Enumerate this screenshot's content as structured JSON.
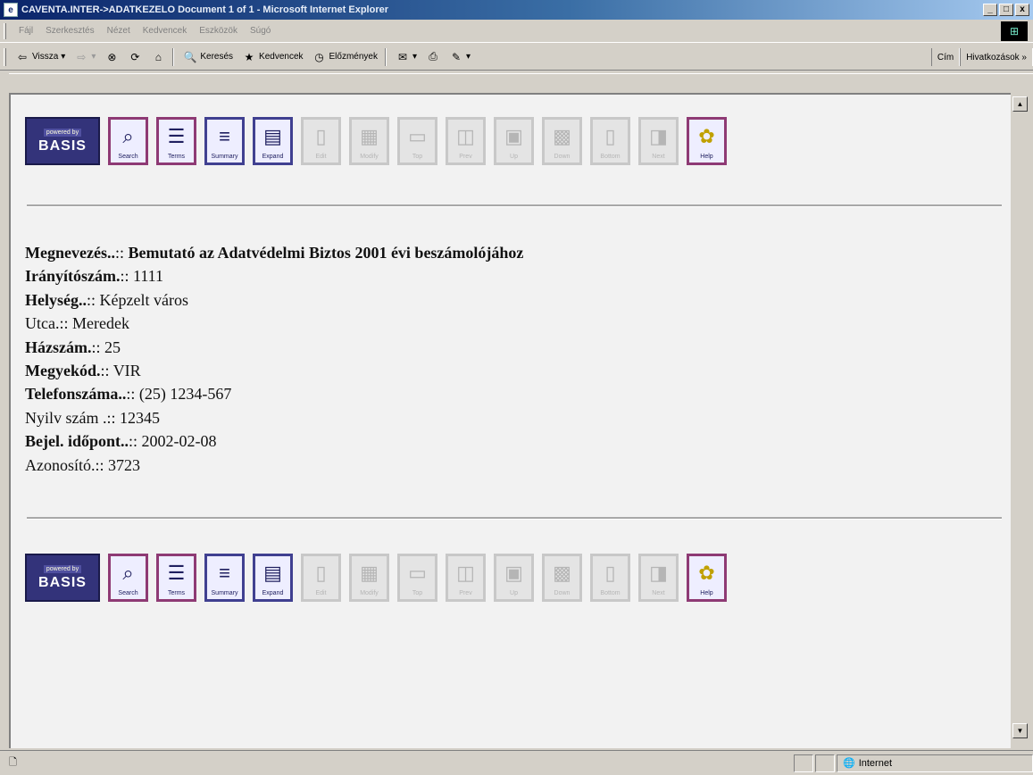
{
  "window": {
    "title": "CAVENTA.INTER->ADATKEZELO Document 1 of 1 - Microsoft Internet Explorer",
    "minimize": "_",
    "maximize": "□",
    "close": "x"
  },
  "menu": [
    "Fájl",
    "Szerkesztés",
    "Nézet",
    "Kedvencek",
    "Eszközök",
    "Súgó"
  ],
  "toolbar": {
    "back": "Vissza",
    "search": "Keresés",
    "favorites": "Kedvencek",
    "history": "Előzmények",
    "address_label": "Cím",
    "links_label": "Hivatkozások »"
  },
  "basis_logo": {
    "powered": "powered by",
    "name": "BASIS"
  },
  "tools": [
    {
      "label": "Search",
      "state": "on-pink",
      "icon": "magnifier-icon"
    },
    {
      "label": "Terms",
      "state": "on-pink",
      "icon": "terms-icon"
    },
    {
      "label": "Summary",
      "state": "on-blue",
      "icon": "summary-icon"
    },
    {
      "label": "Expand",
      "state": "on-blue",
      "icon": "expand-icon"
    },
    {
      "label": "Edit",
      "state": "off",
      "icon": "edit-icon"
    },
    {
      "label": "Modify",
      "state": "off",
      "icon": "modify-icon"
    },
    {
      "label": "Top",
      "state": "off",
      "icon": "top-icon"
    },
    {
      "label": "Prev",
      "state": "off",
      "icon": "prev-icon"
    },
    {
      "label": "Up",
      "state": "off",
      "icon": "up-icon"
    },
    {
      "label": "Down",
      "state": "off",
      "icon": "down-icon"
    },
    {
      "label": "Bottom",
      "state": "off",
      "icon": "bottom-icon"
    },
    {
      "label": "Next",
      "state": "off",
      "icon": "next-icon"
    },
    {
      "label": "Help",
      "state": "help",
      "icon": "help-icon"
    }
  ],
  "record": [
    {
      "label": "Megnevezés..",
      "value": "Bemutató az Adatvédelmi Biztos 2001 évi beszámolójához",
      "bold_value": true
    },
    {
      "label": "Irányítószám.",
      "value": "1111"
    },
    {
      "label": "Helység..",
      "value": "Képzelt város"
    },
    {
      "label": "Utca.",
      "value": "Meredek",
      "plain_label": true
    },
    {
      "label": "Házszám.",
      "value": "25"
    },
    {
      "label": "Megyekód.",
      "value": "VIR"
    },
    {
      "label": "Telefonszáma..",
      "value": "(25) 1234-567"
    },
    {
      "label": "Nyilv szám .",
      "value": "12345",
      "plain_label": true
    },
    {
      "label": "Bejel. időpont..",
      "value": "2002-02-08"
    },
    {
      "label": "Azonosító.",
      "value": "3723",
      "plain_label": true
    }
  ],
  "separator": ":: ",
  "status": {
    "zone": "Internet"
  }
}
